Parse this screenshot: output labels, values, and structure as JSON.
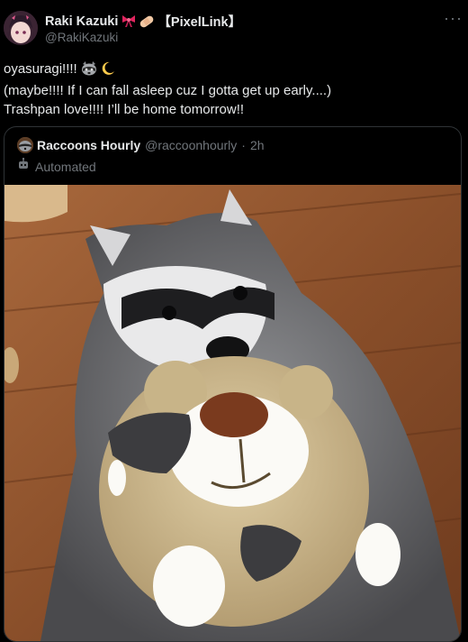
{
  "author": {
    "display_name": "Raki Kazuki",
    "tag": "【PixelLink】",
    "handle": "@RakiKazuki",
    "name_emojis": [
      "ribbon-emoji",
      "bandage-emoji"
    ]
  },
  "menu": {
    "more_label": "···"
  },
  "tweet": {
    "line1_text": "oyasuragi!!!! ",
    "line1_emojis": [
      "raccoon-emoji",
      "crescent-moon-emoji"
    ],
    "line2": "(maybe!!!! If I can fall asleep cuz I gotta get up early....)",
    "line3": "Trashpan love!!!! I’ll be home tomorrow!!"
  },
  "quote": {
    "display_name": "Raccoons Hourly",
    "handle": "@raccoonhourly",
    "separator": "·",
    "time": "2h",
    "automated_label": "Automated",
    "automated_icon": "robot-icon"
  },
  "colors": {
    "background": "#000000",
    "text_primary": "#e7e9ea",
    "text_secondary": "#71767b",
    "border": "#2f3336"
  }
}
